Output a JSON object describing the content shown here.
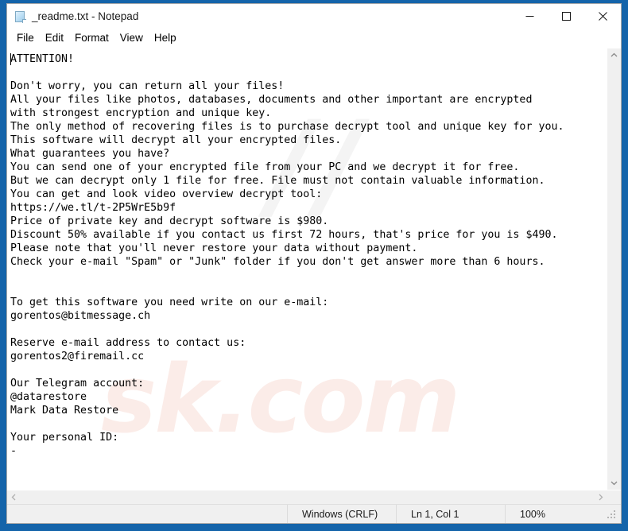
{
  "window": {
    "title": "_readme.txt - Notepad",
    "icon": "notepad-document-icon",
    "accent_color": "#1464aa",
    "controls": {
      "minimize": "minimize-icon",
      "maximize": "maximize-icon",
      "close": "close-icon"
    }
  },
  "menubar": {
    "items": [
      {
        "label": "File"
      },
      {
        "label": "Edit"
      },
      {
        "label": "Format"
      },
      {
        "label": "View"
      },
      {
        "label": "Help"
      }
    ]
  },
  "editor": {
    "text": "ATTENTION!\n\nDon't worry, you can return all your files!\nAll your files like photos, databases, documents and other important are encrypted\nwith strongest encryption and unique key.\nThe only method of recovering files is to purchase decrypt tool and unique key for you.\nThis software will decrypt all your encrypted files.\nWhat guarantees you have?\nYou can send one of your encrypted file from your PC and we decrypt it for free.\nBut we can decrypt only 1 file for free. File must not contain valuable information.\nYou can get and look video overview decrypt tool:\nhttps://we.tl/t-2P5WrE5b9f\nPrice of private key and decrypt software is $980.\nDiscount 50% available if you contact us first 72 hours, that's price for you is $490.\nPlease note that you'll never restore your data without payment.\nCheck your e-mail \"Spam\" or \"Junk\" folder if you don't get answer more than 6 hours.\n\n\nTo get this software you need write on our e-mail:\ngorentos@bitmessage.ch\n\nReserve e-mail address to contact us:\ngorentos2@firemail.cc\n\nOur Telegram account:\n@datarestore\nMark Data Restore\n\nYour personal ID:\n-",
    "watermark": "sk.com",
    "watermark_slash": "//"
  },
  "scrollbars": {
    "vertical": {
      "up": "scroll-up-arrow-icon",
      "down": "scroll-down-arrow-icon"
    },
    "horizontal": {
      "left": "scroll-left-arrow-icon",
      "right": "scroll-right-arrow-icon"
    }
  },
  "statusbar": {
    "line_ending": "Windows (CRLF)",
    "position": "Ln 1, Col 1",
    "zoom": "100%"
  }
}
